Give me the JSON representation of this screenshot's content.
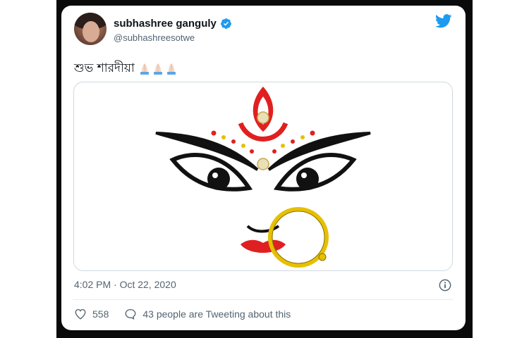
{
  "author": {
    "display_name": "subhashree ganguly",
    "handle": "@subhashreesotwe"
  },
  "tweet": {
    "text": "শুভ শারদীয়া",
    "emoji": "folded-hands-icon x3"
  },
  "media": {
    "description_icon": "durga-face-illustration"
  },
  "meta": {
    "timestamp": "4:02 PM · Oct 22, 2020"
  },
  "actions": {
    "likes": "558",
    "conversation": "43 people are Tweeting about this"
  },
  "colors": {
    "twitter_blue": "#1d9bf0",
    "text_primary": "#0f1419",
    "text_secondary": "#536471",
    "durga_red": "#e02020",
    "gold": "#e6c000"
  },
  "icons": [
    "verified-badge-icon",
    "twitter-bird-icon",
    "info-icon",
    "heart-icon",
    "speech-bubble-icon"
  ]
}
